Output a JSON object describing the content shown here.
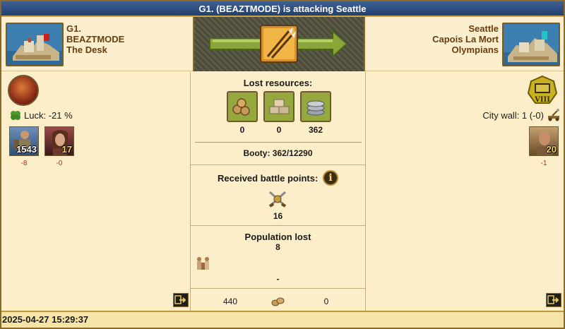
{
  "window": {
    "title": "G1. (BEAZTMODE) is attacking Seattle"
  },
  "attacker": {
    "city": "G1.",
    "player": "BEAZTMODE",
    "alliance": "The Desk",
    "luck_label": "Luck: -21 %",
    "units": [
      {
        "name": "swordsman",
        "count": "1543",
        "lost": "-8"
      },
      {
        "name": "hero",
        "count": "17",
        "lost": "-0"
      }
    ]
  },
  "defender": {
    "city": "Seattle",
    "player": "Capois La Mort",
    "alliance": "Olympians",
    "wall_level": "VIII",
    "citywall_label": "City wall: 1 (-0)",
    "units": [
      {
        "name": "militia",
        "count": "20",
        "lost": "-1"
      }
    ]
  },
  "center": {
    "lost_resources_title": "Lost resources:",
    "resources": [
      {
        "icon": "wood-icon",
        "value": "0"
      },
      {
        "icon": "stone-icon",
        "value": "0"
      },
      {
        "icon": "silver-icon",
        "value": "362"
      }
    ],
    "booty_label": "Booty: 362/12290",
    "battle_points_title": "Received battle points:",
    "battle_points_value": "16",
    "population_title": "Population lost",
    "population_value": "8",
    "population_dash": "-",
    "summary_left": "440",
    "summary_right": "0"
  },
  "footer": {
    "timestamp": "2025-04-27 15:29:37"
  },
  "colors": {
    "title_bg": "#22406e",
    "name_color": "#6b3c0c",
    "loss_color": "#c12020"
  }
}
